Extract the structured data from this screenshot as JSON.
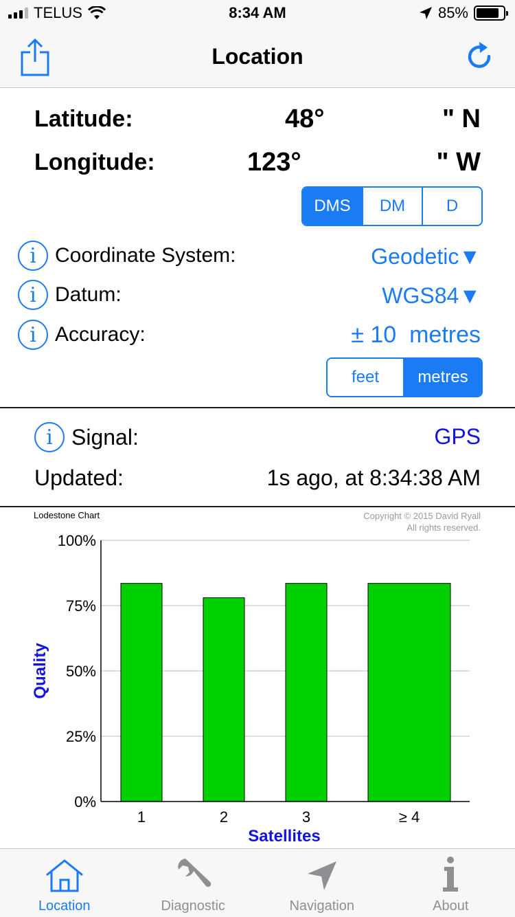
{
  "status": {
    "carrier": "TELUS",
    "time": "8:34 AM",
    "battery": "85%",
    "battery_level": 0.85
  },
  "navbar": {
    "title": "Location",
    "share_icon": "share-icon",
    "refresh_icon": "refresh-icon"
  },
  "coords": {
    "latitude_label": "Latitude:",
    "latitude_value": "48°",
    "latitude_suffix": "\" N",
    "longitude_label": "Longitude:",
    "longitude_value": "123°",
    "longitude_suffix": "\" W"
  },
  "format_segment": {
    "options": [
      "DMS",
      "DM",
      "D"
    ],
    "selected": "DMS"
  },
  "settings": {
    "coord_system_label": "Coordinate System:",
    "coord_system_value": "Geodetic▼",
    "datum_label": "Datum:",
    "datum_value": "WGS84▼",
    "accuracy_label": "Accuracy:",
    "accuracy_value": "± 10  metres"
  },
  "units_segment": {
    "options": [
      "feet",
      "metres"
    ],
    "selected": "metres"
  },
  "signal": {
    "signal_label": "Signal:",
    "signal_value": "GPS",
    "updated_label": "Updated:",
    "updated_value": "1s ago, at 8:34:38 AM"
  },
  "chart_header": {
    "name": "Lodestone Chart",
    "copyright_line1": "Copyright © 2015 David Ryall",
    "copyright_line2": "All rights reserved."
  },
  "colors": {
    "accent": "#1a7bf2",
    "signal": "#1414e0",
    "bar": "#00d000",
    "axis_label": "#1414e0"
  },
  "chart_data": {
    "type": "bar",
    "categories": [
      "1",
      "2",
      "3",
      "≥ 4"
    ],
    "values": [
      83.5,
      78,
      83.5,
      83.5
    ],
    "ylabel": "Quality",
    "xlabel": "Satellites",
    "ylim": [
      0,
      100
    ],
    "yticks": [
      0,
      25,
      50,
      75,
      100
    ],
    "ytick_labels": [
      "0%",
      "25%",
      "50%",
      "75%",
      "100%"
    ],
    "grid": true
  },
  "tabs": [
    {
      "label": "Location",
      "icon": "home-icon",
      "active": true
    },
    {
      "label": "Diagnostic",
      "icon": "wrench-icon",
      "active": false
    },
    {
      "label": "Navigation",
      "icon": "navigation-arrow-icon",
      "active": false
    },
    {
      "label": "About",
      "icon": "info-icon",
      "active": false
    }
  ]
}
